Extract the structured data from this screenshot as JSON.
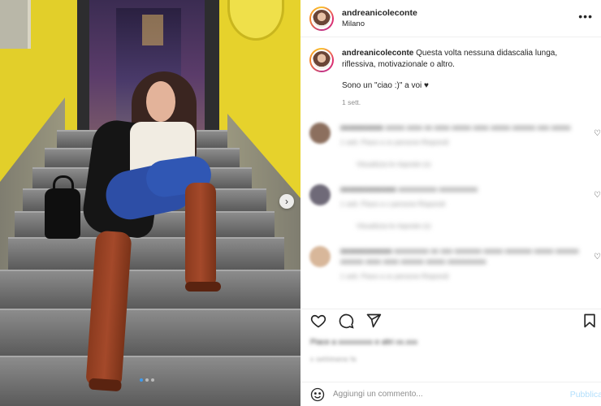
{
  "post": {
    "username": "andreanicoleconte",
    "location": "Milano",
    "more_icon": "more-dots-icon"
  },
  "caption": {
    "username": "andreanicoleconte",
    "text": "Questa volta nessuna didascalia lunga, riflessiva, motivazionale o altro.",
    "text2": "Sono un \"ciao :)\" a voi ♥",
    "time": "1 sett."
  },
  "comments": [
    {
      "user": "xxxxxxxxxx",
      "text": "xxxxx xxxx xx xxxx xxxxx xxxx xxxxx xxxxxx xxx xxxxx",
      "meta": "1 sett.   Piace a xx persone   Rispondi",
      "replies": "Visualizza le risposte (x)",
      "avatar_color": "#8c6f5e"
    },
    {
      "user": "xxxxxxxxxxxxx",
      "text": "xxxxxxxxxx xxxxxxxxxx",
      "meta": "1 sett.   Piace a x persone   Rispondi",
      "replies": "Visualizza le risposte (x)",
      "avatar_color": "#6f6a78"
    },
    {
      "user": "xxxxxxxxxxxx",
      "text": "xxxxxxxxx xx xxx xxxxxxx xxxxx xxxxxxx xxxxx xxxxxx xxxxxx xxxx xxxx xxxxxx xxxxx xxxxxxxxxx",
      "meta": "1 sett.   Piace a xx persone   Rispondi",
      "replies": "",
      "avatar_color": "#d8b79a"
    }
  ],
  "actions": {
    "like_icon": "heart-icon",
    "comment_icon": "comment-bubble-icon",
    "share_icon": "send-icon",
    "save_icon": "bookmark-icon"
  },
  "likes_text": "Piace a xxxxxxxxx e altri xx.xxx",
  "post_time": "x settimana fa",
  "add_comment": {
    "placeholder": "Aggiungi un commento...",
    "publish_label": "Pubblica",
    "emoji_icon": "emoji-smile-icon"
  },
  "carousel": {
    "next_icon": "chevron-right-icon",
    "slides": 3,
    "current": 1
  },
  "colors": {
    "publish": "#b2dffc",
    "secondary_text": "#8e8e8e",
    "text": "#262626",
    "active_dot": "#3d9bf0"
  }
}
